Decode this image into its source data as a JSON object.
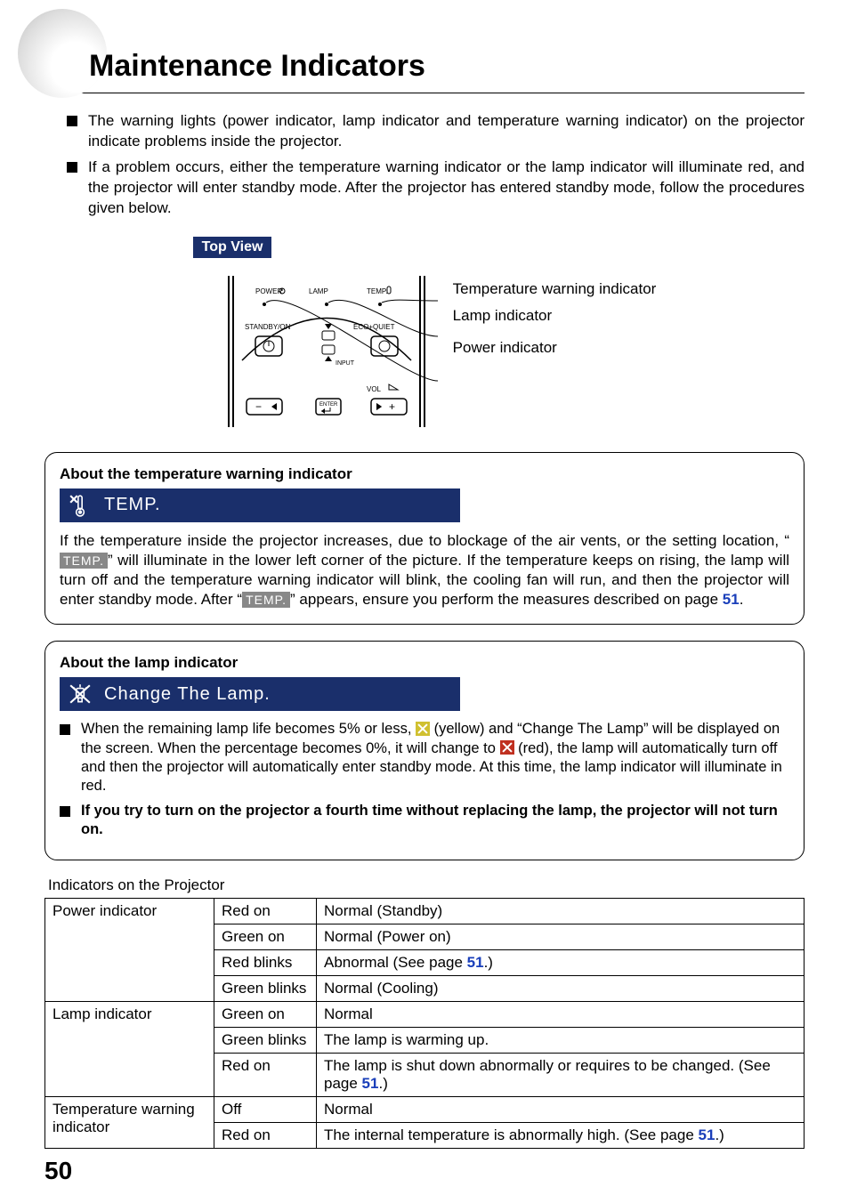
{
  "title": "Maintenance Indicators",
  "intro": [
    "The warning lights (power indicator, lamp indicator and temperature warning indicator) on the projector indicate problems inside the projector.",
    "If a problem occurs, either the temperature warning indicator or the lamp indicator will illuminate red, and the projector will enter standby mode. After the projector has entered standby mode, follow the procedures given below."
  ],
  "topview": {
    "label": "Top View",
    "callouts": {
      "temp": "Temperature warning indicator",
      "lamp": "Lamp indicator",
      "power": "Power indicator"
    },
    "panel_text": {
      "power": "POWER",
      "lamp": "LAMP",
      "temp": "TEMP.",
      "standby": "STANDBY/ON",
      "ecoquiet": "ECO+QUIET",
      "input": "INPUT",
      "vol": "VOL",
      "enter": "ENTER"
    }
  },
  "temp_box": {
    "heading": "About the temperature warning indicator",
    "osd_text": "TEMP.",
    "para_pre": "If the temperature inside the projector increases, due to blockage of the air vents, or the setting location, “",
    "chip1": "TEMP.",
    "para_mid": "” will illuminate in the lower left corner of the picture. If the temperature keeps on rising, the lamp will turn off and the temperature warning indicator will blink, the cooling fan will run, and then the projector will enter standby mode. After “",
    "chip2": "TEMP.",
    "para_post": "” appears, ensure you perform the measures described on page ",
    "page_ref": "51",
    "para_end": "."
  },
  "lamp_box": {
    "heading": "About the lamp indicator",
    "osd_text": "Change The Lamp.",
    "bullets": [
      {
        "t1": "When the remaining lamp life becomes 5% or less, ",
        "icon1_label": "yellow-x-icon",
        "t2": " (yellow) and “Change The Lamp” will be displayed on the screen. When the percentage becomes 0%, it will change to ",
        "icon2_label": "red-x-icon",
        "t3": " (red), the lamp will automatically turn off and then the projector will automatically enter standby mode. At this time, the lamp indicator will illuminate in red."
      },
      {
        "bold": "If you try to turn on the projector a fourth time without replacing the lamp, the projector will not turn on."
      }
    ]
  },
  "table": {
    "caption": "Indicators on the Projector",
    "rows": [
      {
        "col1": "Power indicator",
        "col1_rowspan": 4,
        "col2": "Red on",
        "col3_pre": "Normal (Standby)",
        "ref": ""
      },
      {
        "col2": "Green on",
        "col3_pre": "Normal (Power on)",
        "ref": ""
      },
      {
        "col2": "Red blinks",
        "col3_pre": "Abnormal (See page ",
        "ref": "51",
        "col3_post": ".)"
      },
      {
        "col2": "Green blinks",
        "col3_pre": "Normal (Cooling)",
        "ref": ""
      },
      {
        "col1": "Lamp indicator",
        "col1_rowspan": 3,
        "col2": "Green on",
        "col3_pre": "Normal",
        "ref": ""
      },
      {
        "col2": "Green blinks",
        "col3_pre": "The lamp is warming up.",
        "ref": ""
      },
      {
        "col2": "Red on",
        "col3_pre": "The lamp is shut down abnormally or requires to be changed. (See page ",
        "ref": "51",
        "col3_post": ".)"
      },
      {
        "col1": "Temperature warning indicator",
        "col1_rowspan": 2,
        "col2": "Off",
        "col3_pre": "Normal",
        "ref": ""
      },
      {
        "col2": "Red on",
        "col3_pre": "The internal temperature is abnormally high. (See page ",
        "ref": "51",
        "col3_post": ".)"
      }
    ]
  },
  "page_number": "50"
}
